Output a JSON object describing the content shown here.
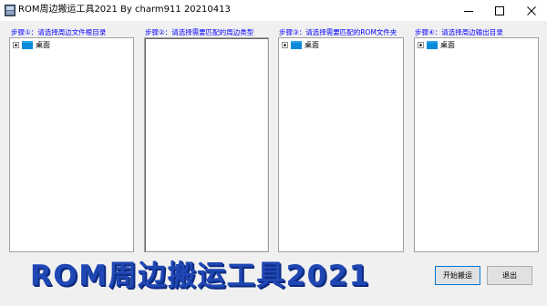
{
  "window": {
    "title": "ROM周边搬运工具2021 By charm911 20210413",
    "controls": {
      "minimize_icon": "minimize-icon",
      "maximize_icon": "maximize-icon",
      "close_icon": "close-icon"
    }
  },
  "panels": [
    {
      "label": "步骤①：请选择周边文件根目录",
      "tree": [
        {
          "label": "桌面",
          "icon": "desktop-folder-icon"
        }
      ]
    },
    {
      "label": "步骤②：请选择需要匹配的周边类型",
      "tree": []
    },
    {
      "label": "步骤③：请选择需要匹配的ROM文件夹",
      "tree": [
        {
          "label": "桌面",
          "icon": "desktop-folder-icon"
        }
      ]
    },
    {
      "label": "步骤④：请选择周边输出目录",
      "tree": [
        {
          "label": "桌面",
          "icon": "desktop-folder-icon"
        }
      ]
    }
  ],
  "banner": {
    "text": "ROM周边搬运工具2021"
  },
  "buttons": {
    "start_label": "开始搬运",
    "exit_label": "退出"
  },
  "colors": {
    "panel_label": "#0000ff",
    "banner": "#1f47b4",
    "window_bg": "#f0f0f0"
  }
}
